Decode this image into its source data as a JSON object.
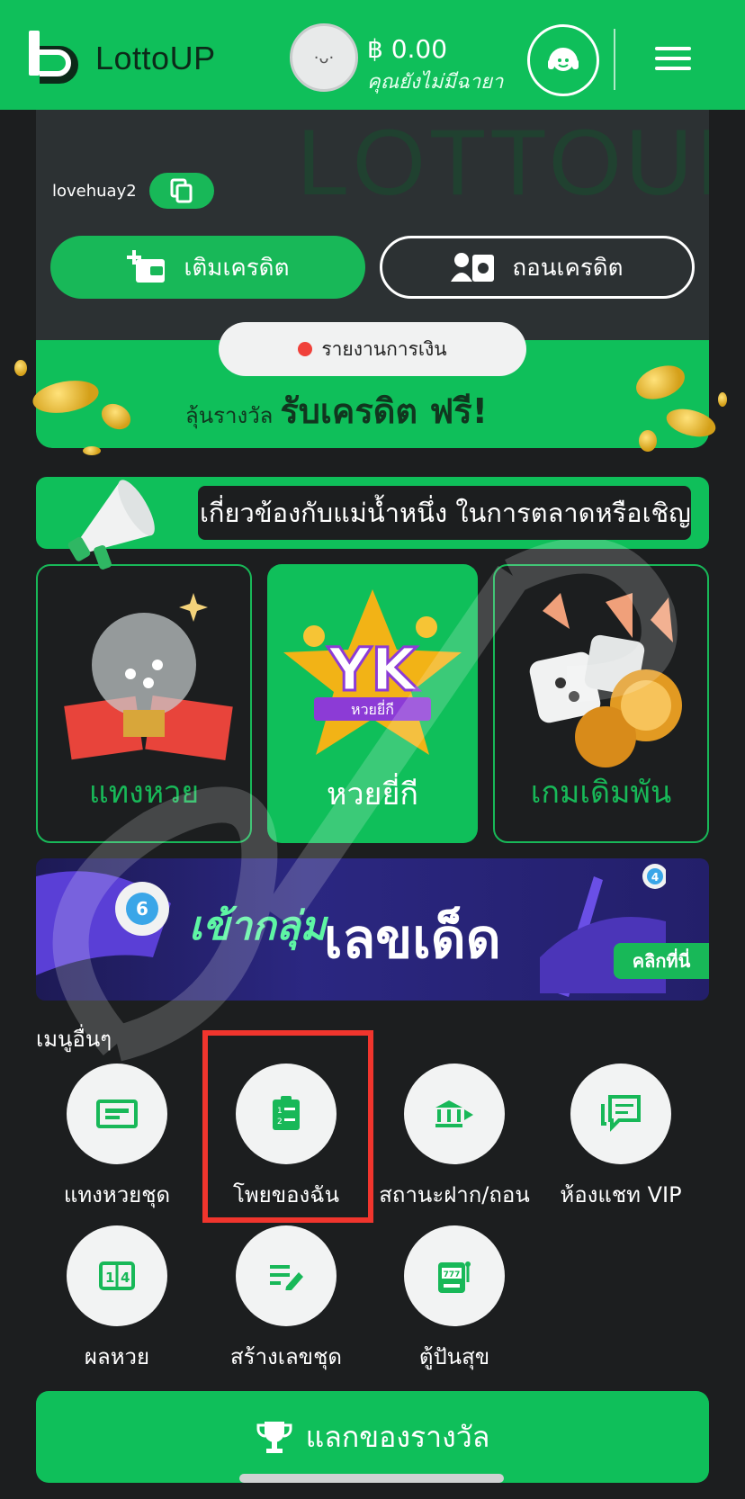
{
  "header": {
    "brand": "LottoUP",
    "balance": "฿ 0.00",
    "balance_sub": "คุณยังไม่มีฉายา"
  },
  "account": {
    "watermark": "LOTTOUP",
    "username": "lovehuay2",
    "deposit_label": "เติมเครดิต",
    "withdraw_label": "ถอนเครดิต",
    "report_label": "รายงานการเงิน",
    "promo_small": "ลุ้นรางวัล",
    "promo_big": "รับเครดิต ฟรี!"
  },
  "announcement": {
    "text": "เกี่ยวข้องกับแม่น้ำหนึ่ง ในการตลาดหรือเชิญ"
  },
  "tiles": [
    {
      "label": "แทงหวย",
      "art": "lottery-machine-icon"
    },
    {
      "label": "หวยยี่กี",
      "art": "yk-badge-icon",
      "badge": "YK",
      "ribbon": "หวยยี่กี"
    },
    {
      "label": "เกมเดิมพัน",
      "art": "dice-coins-icon"
    }
  ],
  "banner": {
    "title_1": "เข้ากลุ่ม",
    "title_2": "เลขเด็ด",
    "cta": "คลิกที่นี่",
    "ball_1": "6",
    "ball_2": "4"
  },
  "menu": {
    "title": "เมนูอื่นๆ",
    "items": [
      {
        "label": "แทงหวยชุด",
        "icon": "ticket-icon"
      },
      {
        "label": "โพยของฉัน",
        "icon": "clipboard-list-icon"
      },
      {
        "label": "สถานะฝาก/ถอน",
        "icon": "bank-transfer-icon"
      },
      {
        "label": "ห้องแชท VIP",
        "icon": "chat-icon"
      },
      {
        "label": "ผลหวย",
        "icon": "lottery-result-icon"
      },
      {
        "label": "สร้างเลขชุด",
        "icon": "edit-list-icon"
      },
      {
        "label": "ตู้ปันสุข",
        "icon": "slot-machine-icon"
      }
    ]
  },
  "reward": {
    "label": "แลกของรางวัล"
  },
  "colors": {
    "brand_green": "#0fbf5a",
    "background": "#1c1e1f",
    "highlight_red": "#f0352d"
  }
}
